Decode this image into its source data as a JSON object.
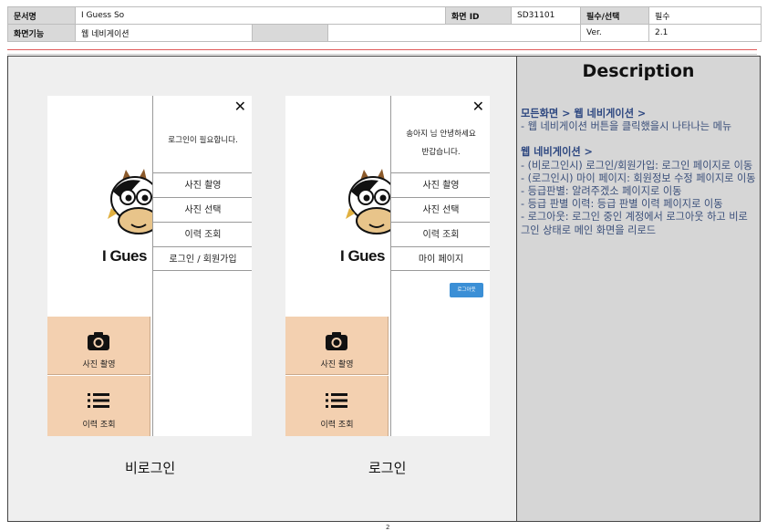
{
  "header": {
    "doc_label": "문서명",
    "doc_value": "I Guess So",
    "screen_id_label": "화면 ID",
    "screen_id_value": "SD31101",
    "required_label": "필수/선택",
    "required_value": "필수",
    "function_label": "화면기능",
    "function_value": "웹 네비게이션",
    "ver_label": "Ver.",
    "ver_value": "2.1"
  },
  "brand": "I Gues",
  "tiles": {
    "photo_label": "사진 촬영",
    "history_label": "이력 조회"
  },
  "drawer_guest": {
    "message": "로그인이 필요합니다.",
    "items": [
      "사진 촬영",
      "사진 선택",
      "이력 조회",
      "로그인 / 회원가입"
    ]
  },
  "drawer_member": {
    "message_line1": "송아지 님 안녕하세요",
    "message_line2": "반갑습니다.",
    "items": [
      "사진 촬영",
      "사진 선택",
      "이력 조회",
      "마이 페이지"
    ],
    "logout": "로그아웃"
  },
  "captions": {
    "guest": "비로그인",
    "member": "로그인"
  },
  "description": {
    "title": "Description",
    "section1_title": "모든화면 > 웹 네비게이션 >",
    "section1_lines": [
      "- 웹 네비게이션 버튼을 클릭했을시 나타나는 메뉴"
    ],
    "section2_title": "웹 네비게이션 >",
    "section2_lines": [
      "- (비로그인시) 로그인/회원가입: 로그인 페이지로 이동",
      "- (로그인시) 마이 페이지: 회원정보 수정 페이지로 이동",
      "- 등급판별: 알려주겠소 페이지로 이동",
      "- 등급 판별 이력: 등급 판별 이력 페이지로 이동",
      "- 로그아웃: 로그인 중인 계정에서 로그아웃 하고 비로그인 상태로 메인 화면을 리로드"
    ]
  },
  "page_number": "2",
  "colors": {
    "tile": "#f3d0b0",
    "description_bg": "#d6d6d6",
    "description_text": "#3a4f7a",
    "logout_button": "#3b8fd6",
    "divider_red": "#e05a5a"
  }
}
